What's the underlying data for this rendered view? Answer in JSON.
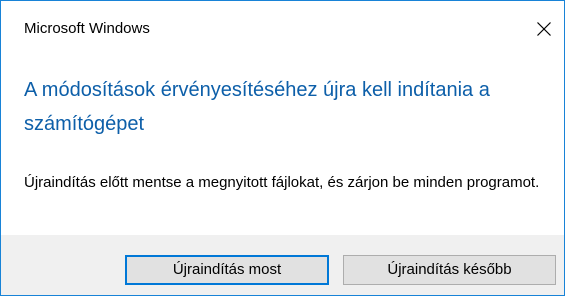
{
  "window": {
    "title": "Microsoft Windows",
    "close_icon": "close-icon"
  },
  "message": {
    "heading": "A módosítások érvényesítéséhez újra kell indítania a számítógépet",
    "body": "Újraindítás előtt mentse a megnyitott fájlokat, és zárjon be minden programot."
  },
  "buttons": {
    "restart_now": "Újraindítás most",
    "restart_later": "Újraindítás később"
  },
  "colors": {
    "accent": "#0078d7",
    "border": "#1883d7",
    "heading": "#0d5fa9",
    "footer_bg": "#f0f0f0"
  }
}
